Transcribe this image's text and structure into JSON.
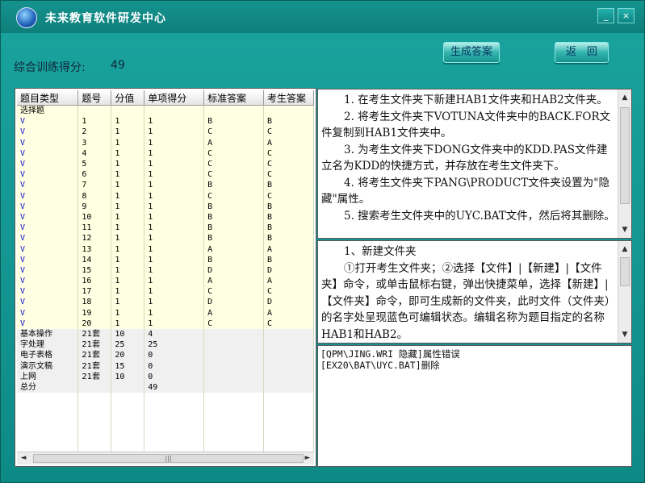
{
  "app": {
    "title": "未来教育软件研发中心"
  },
  "window_controls": {
    "minimize": "_",
    "close": "×"
  },
  "score": {
    "label": "综合训练得分:",
    "value": "49"
  },
  "buttons": {
    "generate_answer": "生成答案",
    "back": "返　回"
  },
  "grid": {
    "columns": [
      "题目类型",
      "题号",
      "分值",
      "单项得分",
      "标准答案",
      "考生答案"
    ],
    "section_choice": "选择题",
    "choice_rows": [
      {
        "t": "V",
        "n": "1",
        "s": "1",
        "g": "1",
        "a": "B",
        "c": "B"
      },
      {
        "t": "V",
        "n": "2",
        "s": "1",
        "g": "1",
        "a": "C",
        "c": "C"
      },
      {
        "t": "V",
        "n": "3",
        "s": "1",
        "g": "1",
        "a": "A",
        "c": "A"
      },
      {
        "t": "V",
        "n": "4",
        "s": "1",
        "g": "1",
        "a": "C",
        "c": "C"
      },
      {
        "t": "V",
        "n": "5",
        "s": "1",
        "g": "1",
        "a": "C",
        "c": "C"
      },
      {
        "t": "V",
        "n": "6",
        "s": "1",
        "g": "1",
        "a": "C",
        "c": "C"
      },
      {
        "t": "V",
        "n": "7",
        "s": "1",
        "g": "1",
        "a": "B",
        "c": "B"
      },
      {
        "t": "V",
        "n": "8",
        "s": "1",
        "g": "1",
        "a": "C",
        "c": "C"
      },
      {
        "t": "V",
        "n": "9",
        "s": "1",
        "g": "1",
        "a": "B",
        "c": "B"
      },
      {
        "t": "V",
        "n": "10",
        "s": "1",
        "g": "1",
        "a": "B",
        "c": "B"
      },
      {
        "t": "V",
        "n": "11",
        "s": "1",
        "g": "1",
        "a": "B",
        "c": "B"
      },
      {
        "t": "V",
        "n": "12",
        "s": "1",
        "g": "1",
        "a": "B",
        "c": "B"
      },
      {
        "t": "V",
        "n": "13",
        "s": "1",
        "g": "1",
        "a": "A",
        "c": "A"
      },
      {
        "t": "V",
        "n": "14",
        "s": "1",
        "g": "1",
        "a": "B",
        "c": "B"
      },
      {
        "t": "V",
        "n": "15",
        "s": "1",
        "g": "1",
        "a": "D",
        "c": "D"
      },
      {
        "t": "V",
        "n": "16",
        "s": "1",
        "g": "1",
        "a": "A",
        "c": "A"
      },
      {
        "t": "V",
        "n": "17",
        "s": "1",
        "g": "1",
        "a": "C",
        "c": "C"
      },
      {
        "t": "V",
        "n": "18",
        "s": "1",
        "g": "1",
        "a": "D",
        "c": "D"
      },
      {
        "t": "V",
        "n": "19",
        "s": "1",
        "g": "1",
        "a": "A",
        "c": "A"
      },
      {
        "t": "V",
        "n": "20",
        "s": "1",
        "g": "1",
        "a": "C",
        "c": "C"
      }
    ],
    "summary_rows": [
      {
        "t": "基本操作",
        "n": "21套",
        "s": "10",
        "g": "4"
      },
      {
        "t": "字处理",
        "n": "21套",
        "s": "25",
        "g": "25"
      },
      {
        "t": "电子表格",
        "n": "21套",
        "s": "20",
        "g": "0"
      },
      {
        "t": "演示文稿",
        "n": "21套",
        "s": "15",
        "g": "0"
      },
      {
        "t": "上网",
        "n": "21套",
        "s": "10",
        "g": "0"
      }
    ],
    "total": {
      "t": "总分",
      "g": "49"
    }
  },
  "scroll": {
    "left": "◄",
    "right": "►",
    "up": "▲",
    "down": "▼",
    "grip": "|||"
  },
  "question_text": [
    "1. 在考生文件夹下新建HAB1文件夹和HAB2文件夹。",
    "2. 将考生文件夹下VOTUNA文件夹中的BACK.FOR文件复制到HAB1文件夹中。",
    "3. 为考生文件夹下DONG文件夹中的KDD.PAS文件建立名为KDD的快捷方式，并存放在考生文件夹下。",
    "4. 将考生文件夹下PANG\\PRODUCT文件夹设置为\"隐藏\"属性。",
    "5. 搜索考生文件夹中的UYC.BAT文件，然后将其删除。"
  ],
  "answer_text": [
    "1、新建文件夹",
    "①打开考生文件夹；②选择【文件】|【新建】|【文件夹】命令，或单击鼠标右键，弹出快捷菜单，选择【新建】|【文件夹】命令，即可生成新的文件夹，此时文件（文件夹）的名字处呈现蓝色可编辑状态。编辑名称为题目指定的名称HAB1和HAB2。"
  ],
  "log_lines": [
    "[QPM\\JING.WRI 隐藏]属性错误",
    "[EX20\\BAT\\UYC.BAT]删除"
  ]
}
